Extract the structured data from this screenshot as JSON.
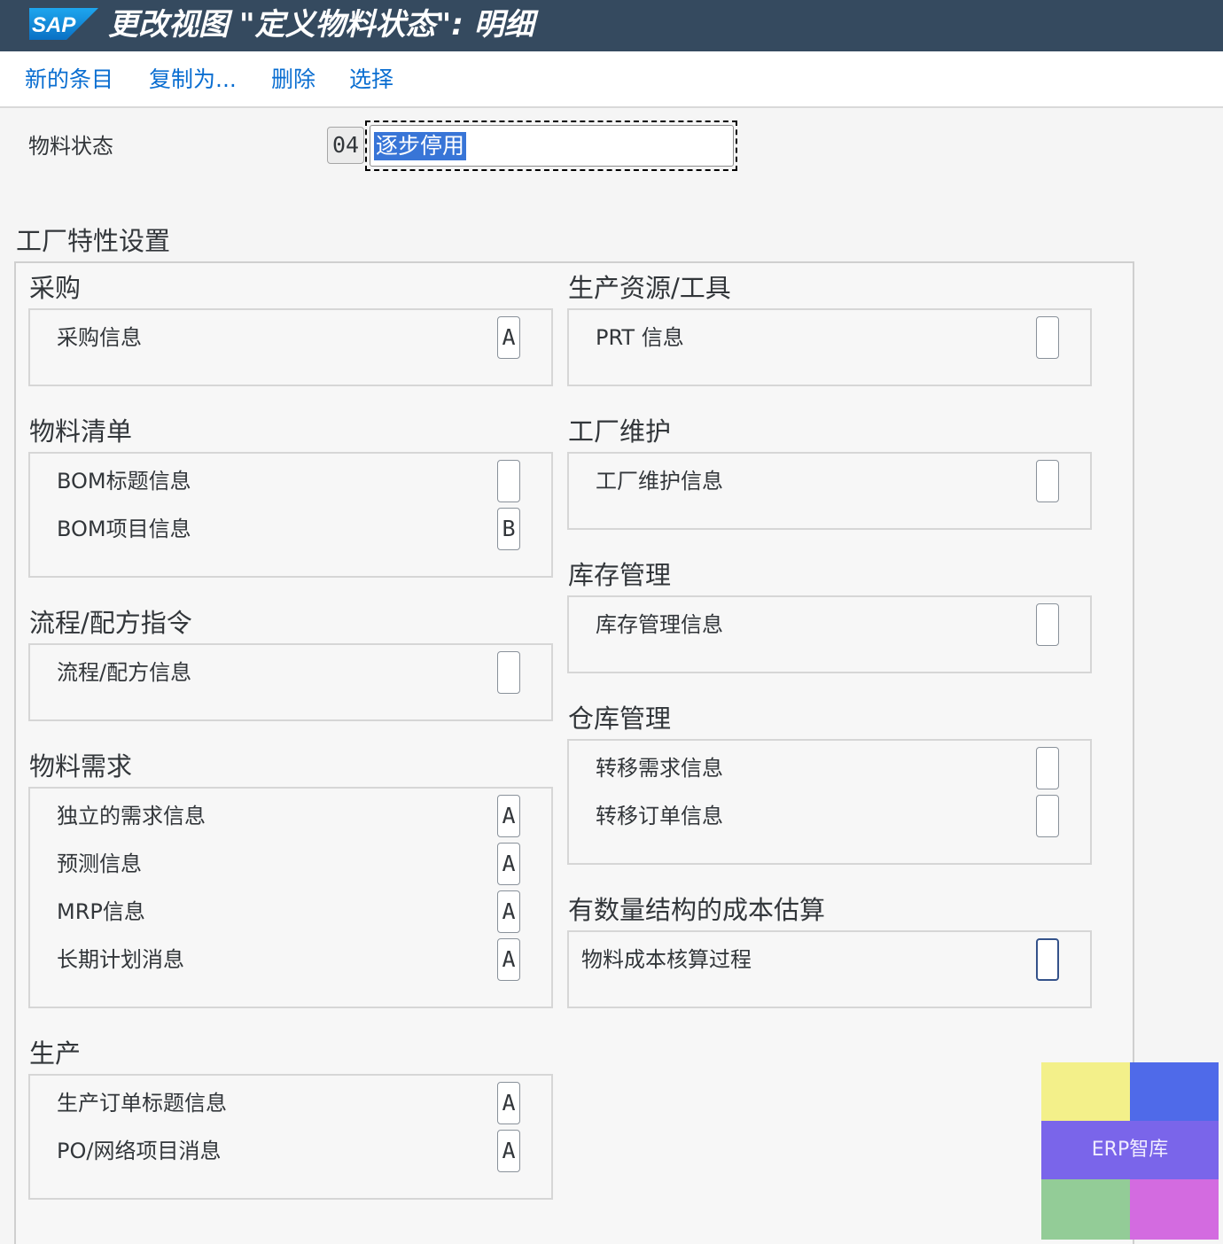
{
  "titlebar": {
    "logo_text": "SAP",
    "title": "更改视图 \"定义物料状态\": 明细"
  },
  "toolbar": {
    "new_entries": "新的条目",
    "copy_as": "复制为...",
    "delete": "删除",
    "select": "选择"
  },
  "header": {
    "material_status_label": "物料状态",
    "material_status_key": "04",
    "material_status_text": "逐步停用"
  },
  "plant_settings": {
    "title": "工厂特性设置",
    "purchasing": {
      "title": "采购",
      "rows": [
        {
          "label": "采购信息",
          "value": "A"
        }
      ]
    },
    "bom": {
      "title": "物料清单",
      "rows": [
        {
          "label": "BOM标题信息",
          "value": ""
        },
        {
          "label": "BOM项目信息",
          "value": "B"
        }
      ]
    },
    "recipe": {
      "title": "流程/配方指令",
      "rows": [
        {
          "label": "流程/配方信息",
          "value": ""
        }
      ]
    },
    "mrp": {
      "title": "物料需求",
      "rows": [
        {
          "label": "独立的需求信息",
          "value": "A"
        },
        {
          "label": "预测信息",
          "value": "A"
        },
        {
          "label": "MRP信息",
          "value": "A"
        },
        {
          "label": "长期计划消息",
          "value": "A"
        }
      ]
    },
    "production": {
      "title": "生产",
      "rows": [
        {
          "label": "生产订单标题信息",
          "value": "A"
        },
        {
          "label": "PO/网络项目消息",
          "value": "A"
        }
      ]
    },
    "prt": {
      "title": "生产资源/工具",
      "rows": [
        {
          "label": "PRT 信息",
          "value": ""
        }
      ]
    },
    "plant_maintenance": {
      "title": "工厂维护",
      "rows": [
        {
          "label": "工厂维护信息",
          "value": ""
        }
      ]
    },
    "inventory": {
      "title": "库存管理",
      "rows": [
        {
          "label": "库存管理信息",
          "value": ""
        }
      ]
    },
    "warehouse": {
      "title": "仓库管理",
      "rows": [
        {
          "label": "转移需求信息",
          "value": ""
        },
        {
          "label": "转移订单信息",
          "value": ""
        }
      ]
    },
    "costing": {
      "title": "有数量结构的成本估算",
      "rows": [
        {
          "label": "物料成本核算过程",
          "value": ""
        }
      ]
    }
  },
  "watermark": {
    "text": "ERP智库",
    "colors": [
      "#f3f08a",
      "#4f6ae9",
      "#7a65ea",
      "#93cc97",
      "#d36be0"
    ]
  },
  "colors": {
    "shell_header": "#354a5f",
    "link": "#0a6ed1",
    "selection": "#3875d7"
  }
}
